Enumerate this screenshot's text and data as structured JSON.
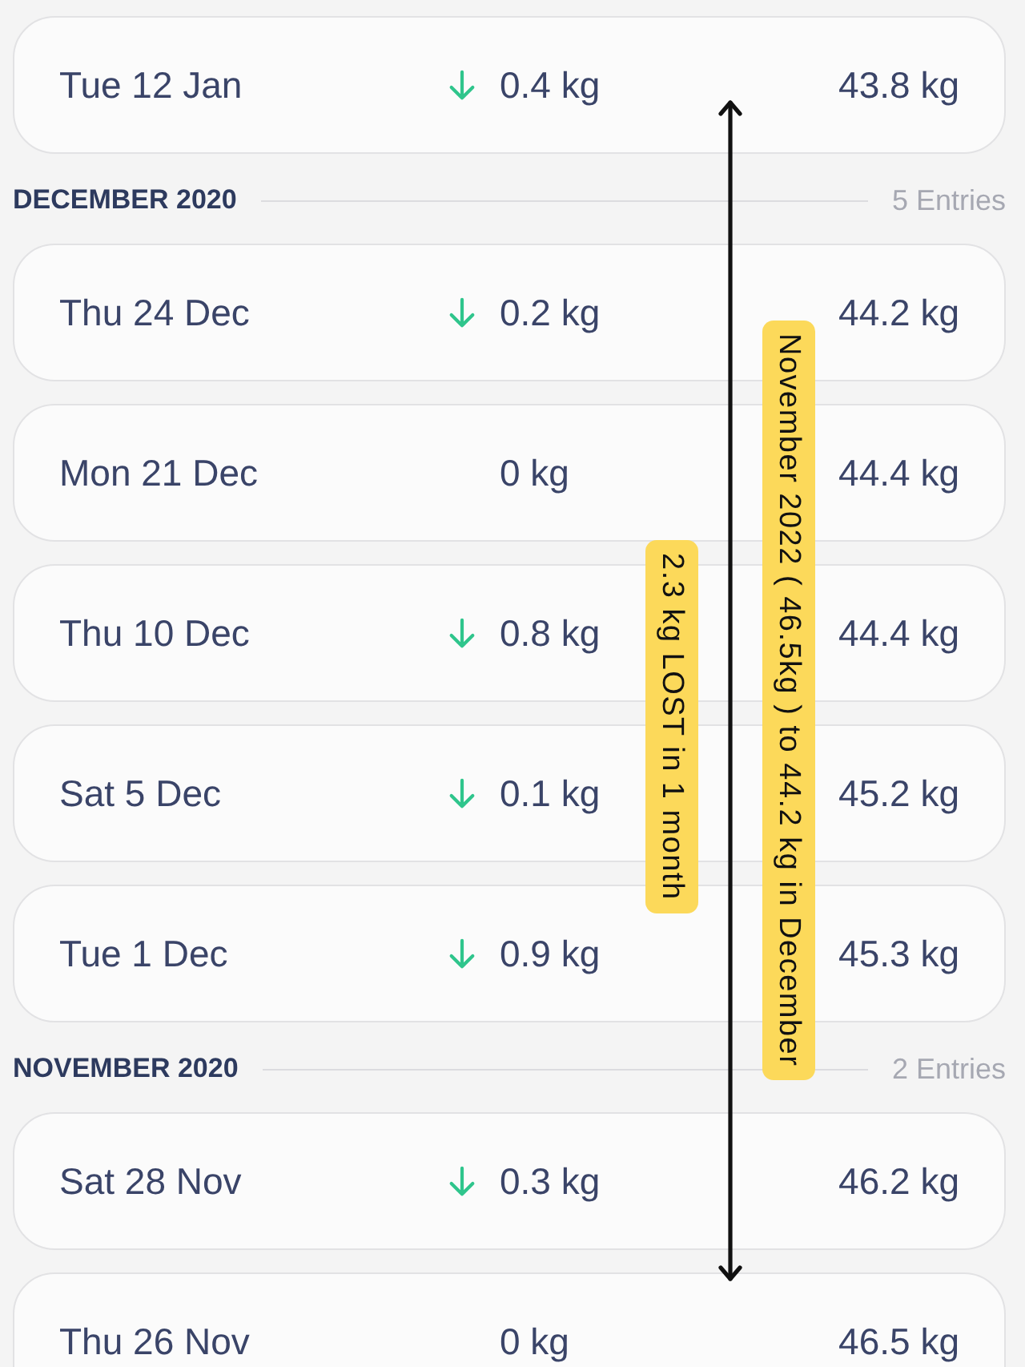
{
  "sections": [
    {
      "entries": [
        {
          "date": "Tue 12 Jan",
          "change": {
            "decreased": true,
            "value": "0.4 kg"
          },
          "weight": "43.8 kg"
        }
      ]
    },
    {
      "title": "DECEMBER 2020",
      "count": "5 Entries",
      "entries": [
        {
          "date": "Thu 24 Dec",
          "change": {
            "decreased": true,
            "value": "0.2 kg"
          },
          "weight": "44.2 kg"
        },
        {
          "date": "Mon 21 Dec",
          "change": {
            "decreased": false,
            "value": "0 kg"
          },
          "weight": "44.4 kg"
        },
        {
          "date": "Thu 10 Dec",
          "change": {
            "decreased": true,
            "value": "0.8 kg"
          },
          "weight": "44.4 kg"
        },
        {
          "date": "Sat 5 Dec",
          "change": {
            "decreased": true,
            "value": "0.1 kg"
          },
          "weight": "45.2 kg"
        },
        {
          "date": "Tue 1 Dec",
          "change": {
            "decreased": true,
            "value": "0.9 kg"
          },
          "weight": "45.3 kg"
        }
      ]
    },
    {
      "title": "NOVEMBER 2020",
      "count": "2 Entries",
      "entries": [
        {
          "date": "Sat 28 Nov",
          "change": {
            "decreased": true,
            "value": "0.3 kg"
          },
          "weight": "46.2 kg"
        },
        {
          "date": "Thu 26 Nov",
          "change": {
            "decreased": false,
            "value": "0 kg"
          },
          "weight": "46.5 kg"
        }
      ]
    }
  ],
  "annotations": [
    {
      "text": "2.3 kg LOST in 1 month"
    },
    {
      "text": "November 2022 ( 46.5kg ) to 44.2 kg in December"
    }
  ]
}
